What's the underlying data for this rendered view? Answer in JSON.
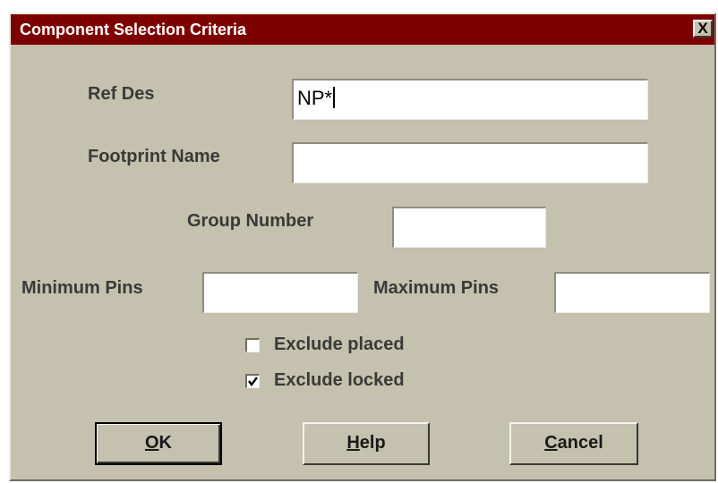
{
  "window": {
    "title": "Component Selection Criteria",
    "close_glyph": "X"
  },
  "form": {
    "ref_des": {
      "label": "Ref Des",
      "value": "NP*"
    },
    "footprint_name": {
      "label": "Footprint Name",
      "value": ""
    },
    "group_number": {
      "label": "Group Number",
      "value": ""
    },
    "minimum_pins": {
      "label": "Minimum Pins",
      "value": ""
    },
    "maximum_pins": {
      "label": "Maximum Pins",
      "value": ""
    },
    "exclude_placed": {
      "label": "Exclude placed",
      "checked": false
    },
    "exclude_locked": {
      "label": "Exclude locked",
      "checked": true
    }
  },
  "buttons": {
    "ok": {
      "mnemonic": "O",
      "rest": "K"
    },
    "help": {
      "mnemonic": "H",
      "rest": "elp"
    },
    "cancel": {
      "mnemonic": "C",
      "rest": "ancel"
    }
  },
  "colors": {
    "titlebar": "#7d0000",
    "dialog_face": "#c4c1ae"
  }
}
